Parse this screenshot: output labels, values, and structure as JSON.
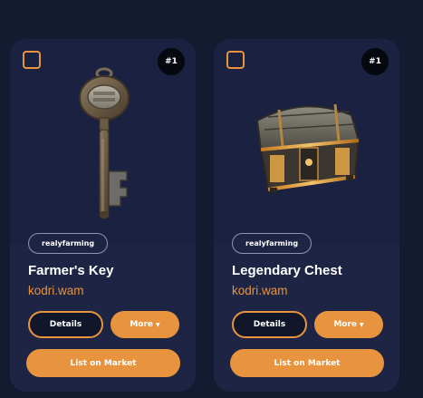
{
  "colors": {
    "accent": "#e8943f",
    "background": "#141a30",
    "card": "#1e2443"
  },
  "cards": [
    {
      "rank": "#1",
      "collection": "realyfarming",
      "name": "Farmer's Key",
      "owner": "kodri.wam",
      "details_label": "Details",
      "more_label": "More",
      "market_label": "List on Market",
      "image_icon": "key-image"
    },
    {
      "rank": "#1",
      "collection": "realyfarming",
      "name": "Legendary Chest",
      "owner": "kodri.wam",
      "details_label": "Details",
      "more_label": "More",
      "market_label": "List on Market",
      "image_icon": "chest-image"
    }
  ]
}
